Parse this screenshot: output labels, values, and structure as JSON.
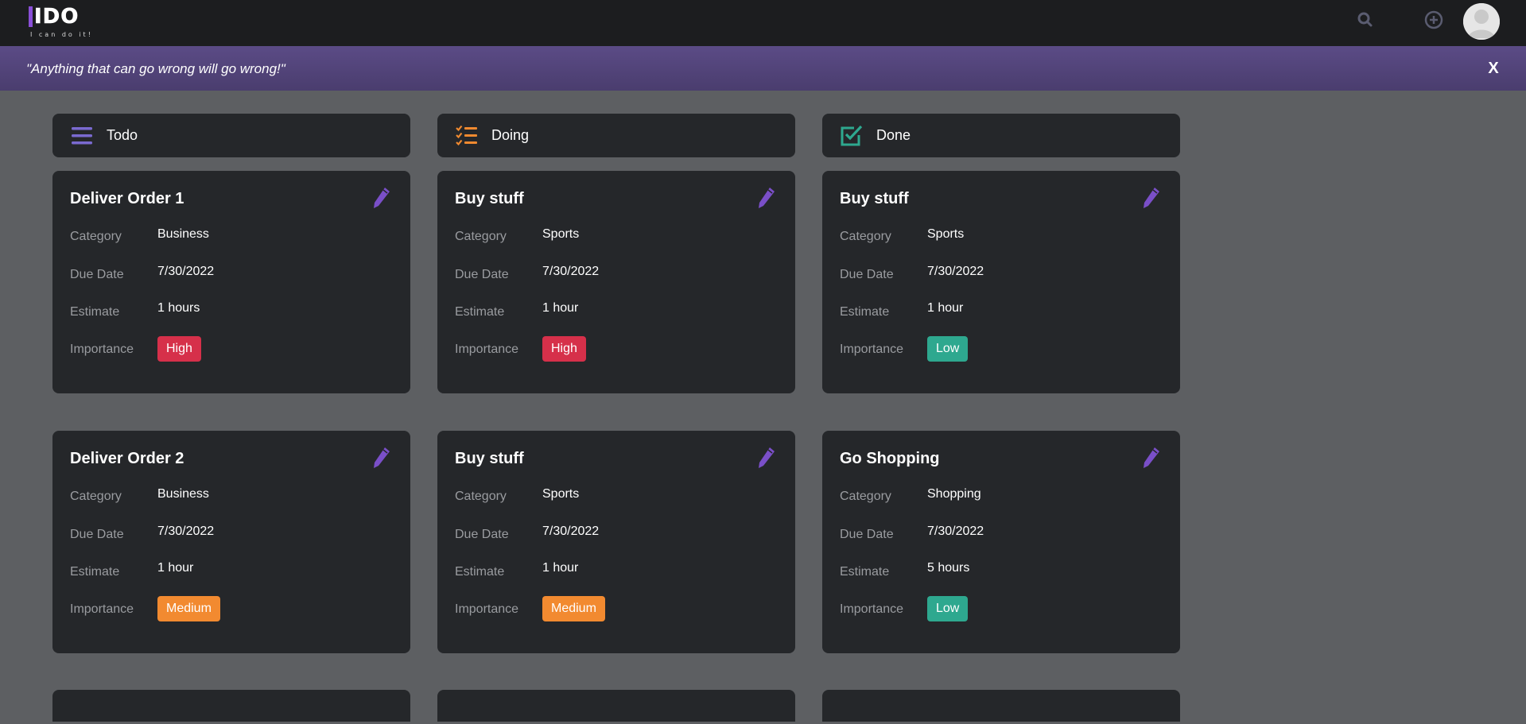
{
  "app": {
    "logo_text": "IDO",
    "logo_tagline": "I can do it!"
  },
  "header": {
    "icons": [
      "search-icon",
      "add-circle-icon",
      "user-avatar"
    ]
  },
  "banner": {
    "quote": "\"Anything that can go wrong will go wrong!\"",
    "close_label": "X"
  },
  "labels": {
    "category": "Category",
    "due_date": "Due Date",
    "estimate": "Estimate",
    "importance": "Importance"
  },
  "colors": {
    "high": "#d6304a",
    "medium": "#f28a30",
    "low": "#2ea88f",
    "todo_icon": "#7a6ad0",
    "doing_icon": "#f08a30",
    "done_icon": "#2ea88f",
    "edit_icon": "#7a4fc8"
  },
  "columns": [
    {
      "title": "Todo",
      "icon": "list-icon",
      "cards": [
        {
          "title": "Deliver Order 1",
          "category": "Business",
          "due_date": "7/30/2022",
          "estimate": "1 hours",
          "importance": "High"
        },
        {
          "title": "Deliver Order 2",
          "category": "Business",
          "due_date": "7/30/2022",
          "estimate": "1 hour",
          "importance": "Medium"
        }
      ]
    },
    {
      "title": "Doing",
      "icon": "checklist-icon",
      "cards": [
        {
          "title": "Buy stuff",
          "category": "Sports",
          "due_date": "7/30/2022",
          "estimate": "1 hour",
          "importance": "High"
        },
        {
          "title": "Buy stuff",
          "category": "Sports",
          "due_date": "7/30/2022",
          "estimate": "1 hour",
          "importance": "Medium"
        }
      ]
    },
    {
      "title": "Done",
      "icon": "checkbox-checked-icon",
      "cards": [
        {
          "title": "Buy stuff",
          "category": "Sports",
          "due_date": "7/30/2022",
          "estimate": "1 hour",
          "importance": "Low"
        },
        {
          "title": "Go Shopping",
          "category": "Shopping",
          "due_date": "7/30/2022",
          "estimate": "5 hours",
          "importance": "Low"
        }
      ]
    }
  ]
}
